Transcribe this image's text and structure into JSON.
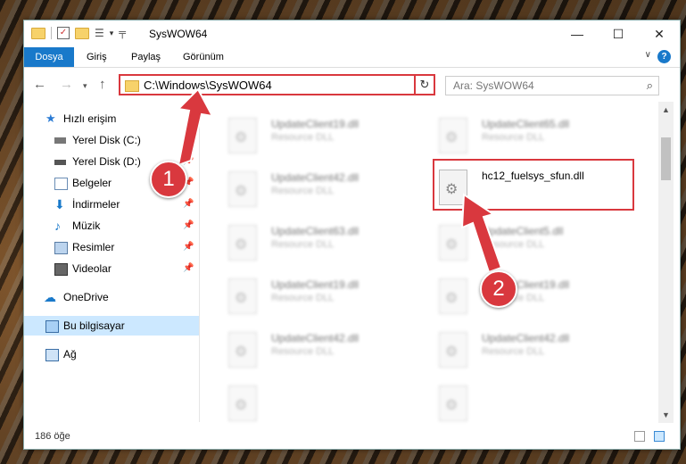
{
  "window": {
    "title": "SysWOW64",
    "minimize": "—",
    "maximize": "☐",
    "close": "✕"
  },
  "ribbon": {
    "tabs": [
      "Dosya",
      "Giriş",
      "Paylaş",
      "Görünüm"
    ],
    "help": "?"
  },
  "nav": {
    "address": "C:\\Windows\\SysWOW64",
    "search_placeholder": "Ara: SysWOW64"
  },
  "sidebar": {
    "quick_access": "Hızlı erişim",
    "items": [
      "Yerel Disk (C:)",
      "Yerel Disk (D:)",
      "Belgeler",
      "İndirmeler",
      "Müzik",
      "Resimler",
      "Videolar"
    ],
    "onedrive": "OneDrive",
    "this_pc": "Bu bilgisayar",
    "network": "Ağ"
  },
  "files": {
    "blurred": [
      {
        "name": "UpdateClient19.dll",
        "type": "Resource DLL"
      },
      {
        "name": "UpdateClient65.dll",
        "type": "Resource DLL"
      },
      {
        "name": "UpdateClient42.dll",
        "type": "Resource DLL"
      },
      {
        "name": "UpdateClient63.dll",
        "type": "Resource DLL"
      },
      {
        "name": "UpdateClient5.dll",
        "type": "Resource DLL"
      },
      {
        "name": "UpdateClient19.dll",
        "type": "Resource DLL"
      },
      {
        "name": "UpdateClient19.dll",
        "type": "Resource DLL"
      },
      {
        "name": "UpdateClient42.dll",
        "type": "Resource DLL"
      },
      {
        "name": "UpdateClient42.dll",
        "type": "Resource DLL"
      }
    ],
    "highlighted": {
      "name": "hc12_fuelsys_sfun.dll"
    }
  },
  "status": {
    "count": "186 öğe"
  },
  "callouts": [
    "1",
    "2"
  ],
  "colors": {
    "accent": "#1979ca",
    "highlight": "#d9383e",
    "selected": "#cce8ff"
  }
}
